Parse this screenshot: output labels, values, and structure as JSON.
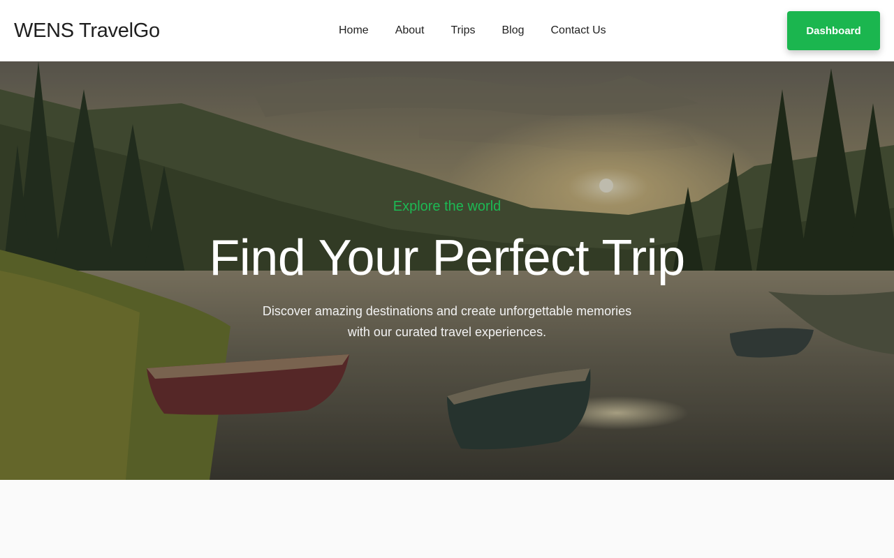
{
  "header": {
    "brand": "WENS TravelGo",
    "nav": [
      {
        "label": "Home"
      },
      {
        "label": "About"
      },
      {
        "label": "Trips"
      },
      {
        "label": "Blog"
      },
      {
        "label": "Contact Us"
      }
    ],
    "dashboard_label": "Dashboard"
  },
  "hero": {
    "eyebrow": "Explore the world",
    "title": "Find Your Perfect Trip",
    "subtitle": "Discover amazing destinations and create unforgettable memories with our curated travel experiences."
  },
  "colors": {
    "accent": "#1bb64f",
    "header_bg": "#ffffff",
    "page_bg": "#fafafa",
    "text_dark": "#1f1f1f"
  }
}
